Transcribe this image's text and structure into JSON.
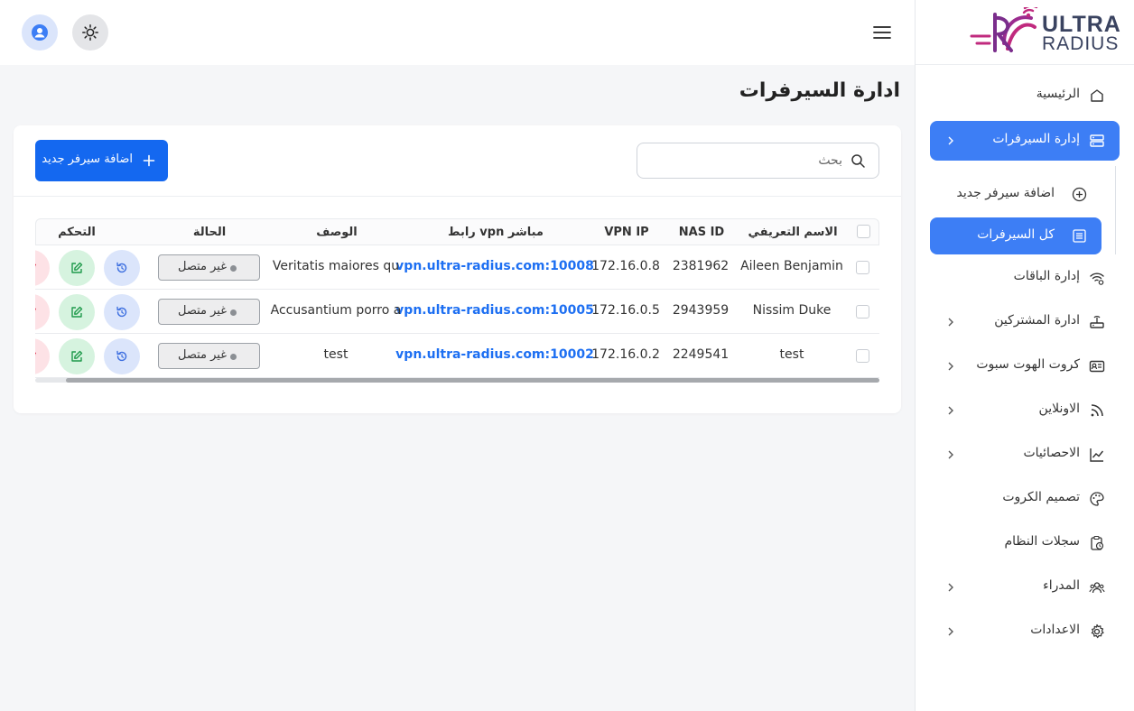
{
  "brand": {
    "line1": "ULTRA",
    "line2": "RADIUS"
  },
  "page": {
    "title": "ادارة السيرفرات"
  },
  "search": {
    "placeholder": "بحث"
  },
  "add_button": {
    "label": "اضافة سيرفر جديد"
  },
  "sidebar": {
    "items": [
      {
        "label": "الرئيسية",
        "icon": "home-icon"
      },
      {
        "label": "إدارة السيرفرات",
        "icon": "server-icon",
        "active": true,
        "expanded": true
      },
      {
        "label": "إدارة الباقات",
        "icon": "wifi-settings-icon"
      },
      {
        "label": "ادارة المشتركين",
        "icon": "router-icon"
      },
      {
        "label": "كروت الهوت سبوت",
        "icon": "id-card-icon"
      },
      {
        "label": "الاونلاين",
        "icon": "rss-icon"
      },
      {
        "label": "الاحصائيات",
        "icon": "line-chart-icon"
      },
      {
        "label": "تصميم الكروت",
        "icon": "palette-icon"
      },
      {
        "label": "سجلات النظام",
        "icon": "clipboard-clock-icon"
      },
      {
        "label": "المدراء",
        "icon": "users-icon"
      },
      {
        "label": "الاعدادات",
        "icon": "gear-icon"
      }
    ],
    "subitems": [
      {
        "label": "اضافة سيرفر جديد",
        "icon": "plus-circle-icon"
      },
      {
        "label": "كل السيرفرات",
        "icon": "list-icon",
        "active": true
      }
    ]
  },
  "table": {
    "columns": [
      "الاسم التعريفي",
      "NAS ID",
      "VPN IP",
      "رابط vpn مباشر",
      "الوصف",
      "الحالة",
      "التحكم"
    ],
    "rows": [
      {
        "name": "Aileen Benjamin",
        "nas_id": "2381962",
        "vpn_ip": "172.16.0.8",
        "vpn_link": "vpn.ultra-radius.com:10008",
        "description": "Veritatis maiores qu",
        "status": "غير متصل"
      },
      {
        "name": "Nissim Duke",
        "nas_id": "2943959",
        "vpn_ip": "172.16.0.5",
        "vpn_link": "vpn.ultra-radius.com:10005",
        "description": "Accusantium porro a",
        "status": "غير متصل"
      },
      {
        "name": "test",
        "nas_id": "2249541",
        "vpn_ip": "172.16.0.2",
        "vpn_link": "vpn.ultra-radius.com:10002",
        "description": "test",
        "status": "غير متصل"
      }
    ]
  },
  "colors": {
    "primary": "#1468f0",
    "active_nav": "#3d7ef5",
    "link": "#1d6ff2"
  }
}
